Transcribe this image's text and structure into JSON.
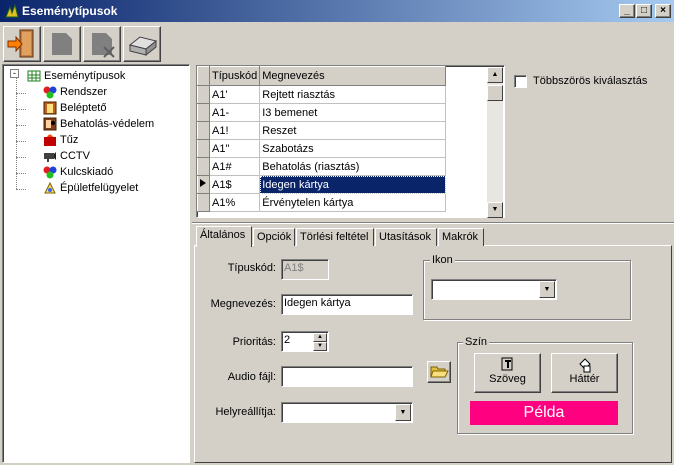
{
  "window": {
    "title": "Eseménytípusok"
  },
  "tree": {
    "root": "Eseménytípusok",
    "items": [
      "Rendszer",
      "Beléptető",
      "Behatolás-védelem",
      "Tűz",
      "CCTV",
      "Kulcskiadó",
      "Épületfelügyelet"
    ]
  },
  "grid": {
    "headers": [
      "Típuskód",
      "Megnevezés"
    ],
    "rows": [
      [
        "A1'",
        "Rejtett riasztás"
      ],
      [
        "A1-",
        "I3 bemenet"
      ],
      [
        "A1!",
        "Reszet"
      ],
      [
        "A1\"",
        "Szabotázs"
      ],
      [
        "A1#",
        "Behatolás (riasztás)"
      ],
      [
        "A1$",
        "Idegen kártya"
      ],
      [
        "A1%",
        "Érvénytelen kártya"
      ]
    ],
    "selected_row": 5
  },
  "multi_select": {
    "label": "Többszörös kiválasztás",
    "checked": false
  },
  "tabs": [
    "Általános",
    "Opciók",
    "Törlési feltétel",
    "Utasítások",
    "Makrók"
  ],
  "form": {
    "tipuskod_label": "Típuskód:",
    "tipuskod_value": "A1$",
    "megnevezes_label": "Megnevezés:",
    "megnevezes_value": "Idegen kártya",
    "prioritas_label": "Prioritás:",
    "prioritas_value": "2",
    "audio_label": "Audio fájl:",
    "audio_value": "",
    "helyreallitja_label": "Helyreállítja:",
    "helyreallitja_value": "",
    "ikon_label": "Ikon",
    "ikon_value": "",
    "szin_label": "Szín",
    "szoveg_button": "Szöveg",
    "hatter_button": "Háttér",
    "pelda_label": "Példa",
    "pelda_color": "#ff0080"
  }
}
